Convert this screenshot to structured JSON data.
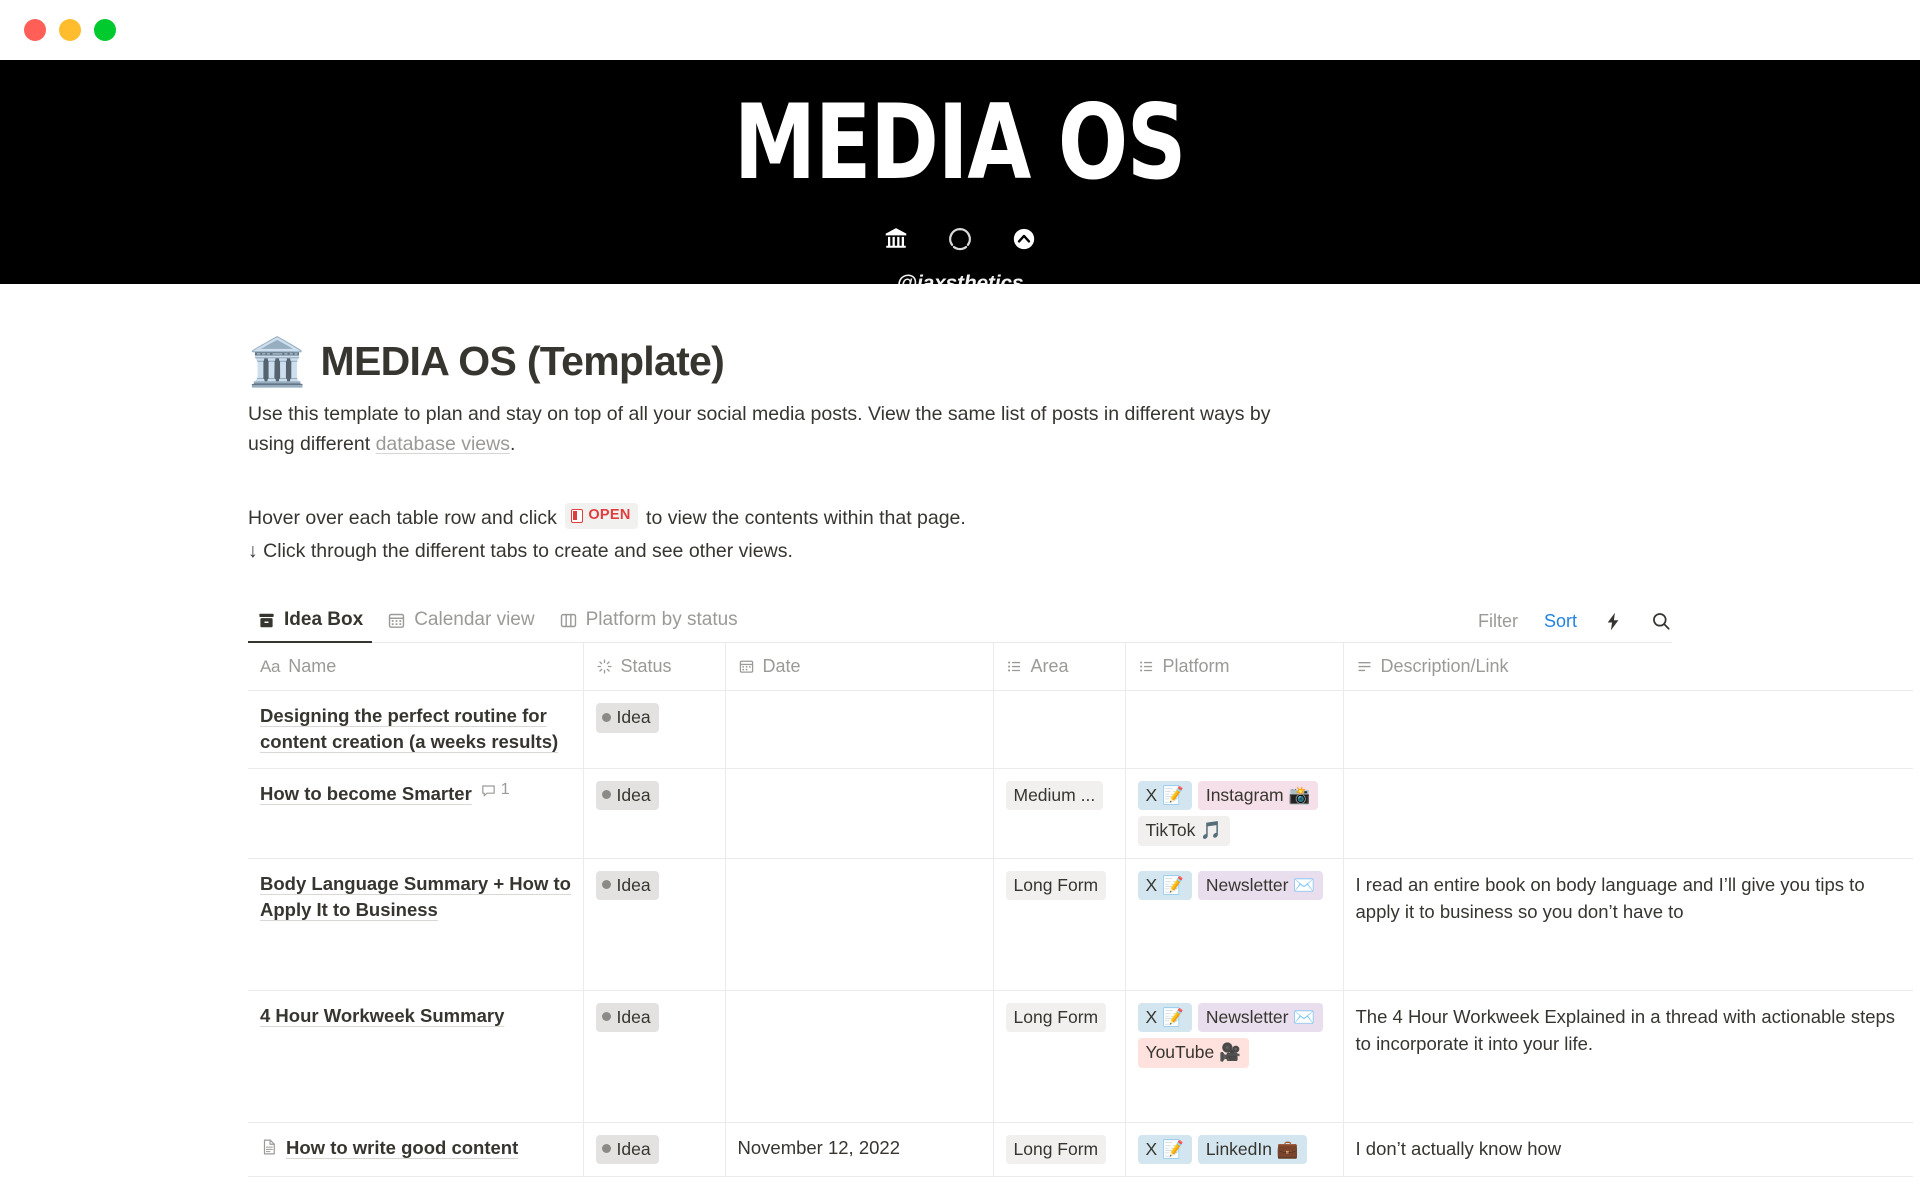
{
  "window": {
    "lights": [
      {
        "name": "close-button",
        "color": "#FF5F57"
      },
      {
        "name": "minimize-button",
        "color": "#FFBD2E"
      },
      {
        "name": "zoom-button",
        "color": "#00CA2E"
      }
    ]
  },
  "cover": {
    "title": "MEDIA OS",
    "handle": "@jaxsthetics",
    "icons": [
      "classical-building-icon",
      "broken-circle-icon",
      "circled-chevron-up-icon"
    ],
    "background": "#000000"
  },
  "page": {
    "emoji": "🏛️",
    "title": "MEDIA OS (Template)",
    "intro_part1": "Use this template to plan and stay on top of all your social media posts. View the same list of posts in different ways by using different ",
    "intro_link": "database views",
    "intro_part2": ".",
    "hint_part1": "Hover over each table row and click ",
    "hint_badge": "OPEN",
    "hint_part2": " to view the contents within that page.",
    "hint_line2": "↓ Click through the different tabs to create and see other views."
  },
  "tabs": [
    {
      "label": "Idea Box",
      "icon": "table-view-icon",
      "active": true
    },
    {
      "label": "Calendar view",
      "icon": "calendar-icon",
      "active": false
    },
    {
      "label": "Platform by status",
      "icon": "board-icon",
      "active": false
    }
  ],
  "toolbar": {
    "filter_label": "Filter",
    "sort_label": "Sort",
    "automation_icon": "lightning-bolt-icon",
    "search_icon": "search-icon",
    "sort_color": "#2383e2"
  },
  "table": {
    "columns": [
      {
        "label": "Name",
        "icon": "title-aa-icon"
      },
      {
        "label": "Status",
        "icon": "status-icon"
      },
      {
        "label": "Date",
        "icon": "calendar-icon"
      },
      {
        "label": "Area",
        "icon": "multi-select-icon"
      },
      {
        "label": "Platform",
        "icon": "multi-select-icon"
      },
      {
        "label": "Description/Link",
        "icon": "text-lines-icon"
      }
    ],
    "rows": [
      {
        "name": "Designing the perfect routine for content creation (a weeks results)",
        "has_page_icon": false,
        "comments": null,
        "status": "Idea",
        "date": "",
        "area": "",
        "platforms": [],
        "description": ""
      },
      {
        "name": "How to become Smarter",
        "has_page_icon": false,
        "comments": "1",
        "status": "Idea",
        "date": "",
        "area": "Medium ...",
        "platforms": [
          {
            "label": "X 📝",
            "color": "blue"
          },
          {
            "label": "Instagram 📸",
            "color": "pink"
          },
          {
            "label": "TikTok 🎵",
            "color": "gray"
          }
        ],
        "description": ""
      },
      {
        "name": "Body Language Summary + How to Apply It to Business",
        "has_page_icon": false,
        "comments": null,
        "status": "Idea",
        "date": "",
        "area": "Long Form",
        "platforms": [
          {
            "label": "X 📝",
            "color": "blue"
          },
          {
            "label": "Newsletter ✉️",
            "color": "purple"
          }
        ],
        "description": "I read an entire book on body language and I’ll give you tips to apply it to business so you don’t have to"
      },
      {
        "name": "4 Hour Workweek Summary",
        "has_page_icon": false,
        "comments": null,
        "status": "Idea",
        "date": "",
        "area": "Long Form",
        "platforms": [
          {
            "label": "X 📝",
            "color": "blue"
          },
          {
            "label": "Newsletter ✉️",
            "color": "purple"
          },
          {
            "label": "YouTube 🎥",
            "color": "red"
          }
        ],
        "description": "The 4 Hour Workweek Explained in a thread with actionable steps to incorporate it into your life."
      },
      {
        "name": "How to write good content",
        "has_page_icon": true,
        "comments": null,
        "status": "Idea",
        "date": "November 12, 2022",
        "area": "Long Form",
        "platforms": [
          {
            "label": "X 📝",
            "color": "blue"
          },
          {
            "label": "LinkedIn 💼",
            "color": "blue"
          }
        ],
        "description": "I don’t actually know how"
      }
    ]
  }
}
